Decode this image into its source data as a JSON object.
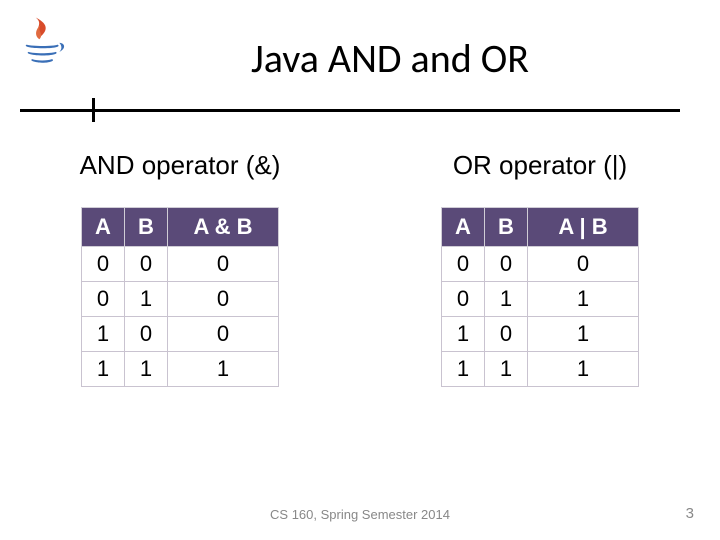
{
  "title": "Java AND and OR",
  "left": {
    "heading": "AND operator (&)",
    "headers": {
      "a": "A",
      "b": "B",
      "r": "A & B"
    },
    "rows": [
      {
        "a": "0",
        "b": "0",
        "r": "0"
      },
      {
        "a": "0",
        "b": "1",
        "r": "0"
      },
      {
        "a": "1",
        "b": "0",
        "r": "0"
      },
      {
        "a": "1",
        "b": "1",
        "r": "1"
      }
    ]
  },
  "right": {
    "heading": "OR operator (|)",
    "headers": {
      "a": "A",
      "b": "B",
      "r": "A | B"
    },
    "rows": [
      {
        "a": "0",
        "b": "0",
        "r": "0"
      },
      {
        "a": "0",
        "b": "1",
        "r": "1"
      },
      {
        "a": "1",
        "b": "0",
        "r": "1"
      },
      {
        "a": "1",
        "b": "1",
        "r": "1"
      }
    ]
  },
  "footer": "CS 160, Spring Semester 2014",
  "page": "3",
  "chart_data": [
    {
      "type": "table",
      "title": "AND operator (&)",
      "columns": [
        "A",
        "B",
        "A & B"
      ],
      "rows": [
        [
          0,
          0,
          0
        ],
        [
          0,
          1,
          0
        ],
        [
          1,
          0,
          0
        ],
        [
          1,
          1,
          1
        ]
      ]
    },
    {
      "type": "table",
      "title": "OR operator (|)",
      "columns": [
        "A",
        "B",
        "A | B"
      ],
      "rows": [
        [
          0,
          0,
          0
        ],
        [
          0,
          1,
          1
        ],
        [
          1,
          0,
          1
        ],
        [
          1,
          1,
          1
        ]
      ]
    }
  ]
}
